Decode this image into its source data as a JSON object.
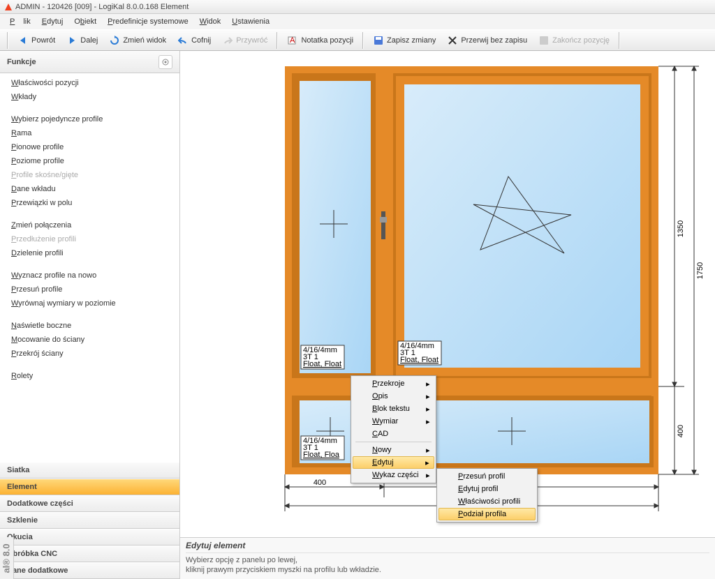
{
  "title": "ADMIN - 120426 [009] - LogiKal 8.0.0.168 Element",
  "menubar": {
    "file": "Plik",
    "edit": "Edytuj",
    "object": "Obiekt",
    "predef": "Predefinicje systemowe",
    "view": "Widok",
    "settings": "Ustawienia"
  },
  "toolbar": {
    "back": "Powrót",
    "next": "Dalej",
    "changeview": "Zmień widok",
    "undo": "Cofnij",
    "redo": "Przywróć",
    "posnote": "Notatka pozycji",
    "save": "Zapisz zmiany",
    "cancel": "Przerwij bez zapisu",
    "finish": "Zakończ pozycję"
  },
  "sidebar": {
    "header": "Funkcje",
    "items": [
      {
        "t": "Właściwości pozycji"
      },
      {
        "t": "Wkłady"
      },
      {
        "spacer": true
      },
      {
        "t": "Wybierz pojedyncze profile"
      },
      {
        "t": "Rama"
      },
      {
        "t": "Pionowe profile"
      },
      {
        "t": "Poziome profile"
      },
      {
        "t": "Profile skośne/gięte",
        "disabled": true
      },
      {
        "t": "Dane wkładu"
      },
      {
        "t": "Przewiązki w polu"
      },
      {
        "spacer": true
      },
      {
        "t": "Zmień połączenia"
      },
      {
        "t": "Przedłużenie profili",
        "disabled": true
      },
      {
        "t": "Dzielenie profili"
      },
      {
        "spacer": true
      },
      {
        "t": "Wyznacz profile na nowo"
      },
      {
        "t": "Przesuń profile"
      },
      {
        "t": "Wyrównaj wymiary w poziomie"
      },
      {
        "spacer": true
      },
      {
        "t": "Naświetle boczne"
      },
      {
        "t": "Mocowanie do ściany"
      },
      {
        "t": "Przekrój ściany"
      },
      {
        "spacer": true
      },
      {
        "t": "Rolety"
      }
    ],
    "groups": [
      "Siatka",
      "Element",
      "Dodatkowe części",
      "Szklenie",
      "Okucia",
      "Obróbka CNC",
      "Dane dodatkowe"
    ],
    "active_group": "Element"
  },
  "canvas": {
    "dims_w1": "400",
    "dims_h1": "1350",
    "dims_h2": "1750",
    "dims_h3": "400",
    "glass_label": "4/16/4mm\n3T 1\nFloat, Float"
  },
  "ctx1": {
    "items": [
      {
        "t": "Przekroje",
        "sub": true
      },
      {
        "t": "Opis",
        "sub": true
      },
      {
        "t": "Blok tekstu",
        "sub": true
      },
      {
        "t": "Wymiar",
        "sub": true
      },
      {
        "t": "CAD"
      },
      {
        "hr": true
      },
      {
        "t": "Nowy",
        "sub": true
      },
      {
        "t": "Edytuj",
        "sub": true,
        "hi": true
      },
      {
        "t": "Wykaz części",
        "sub": true
      }
    ]
  },
  "ctx2": {
    "items": [
      {
        "t": "Przesuń profil"
      },
      {
        "t": "Edytuj profil"
      },
      {
        "t": "Właściwości profili"
      },
      {
        "t": "Podział profila",
        "hi": true
      }
    ]
  },
  "footer": {
    "title": "Edytuj element",
    "line1": "Wybierz opcję z panelu po lewej,",
    "line2": "kliknij prawym przyciskiem myszki na profilu lub wkładzie."
  },
  "leftstrip": "al® 8.0"
}
